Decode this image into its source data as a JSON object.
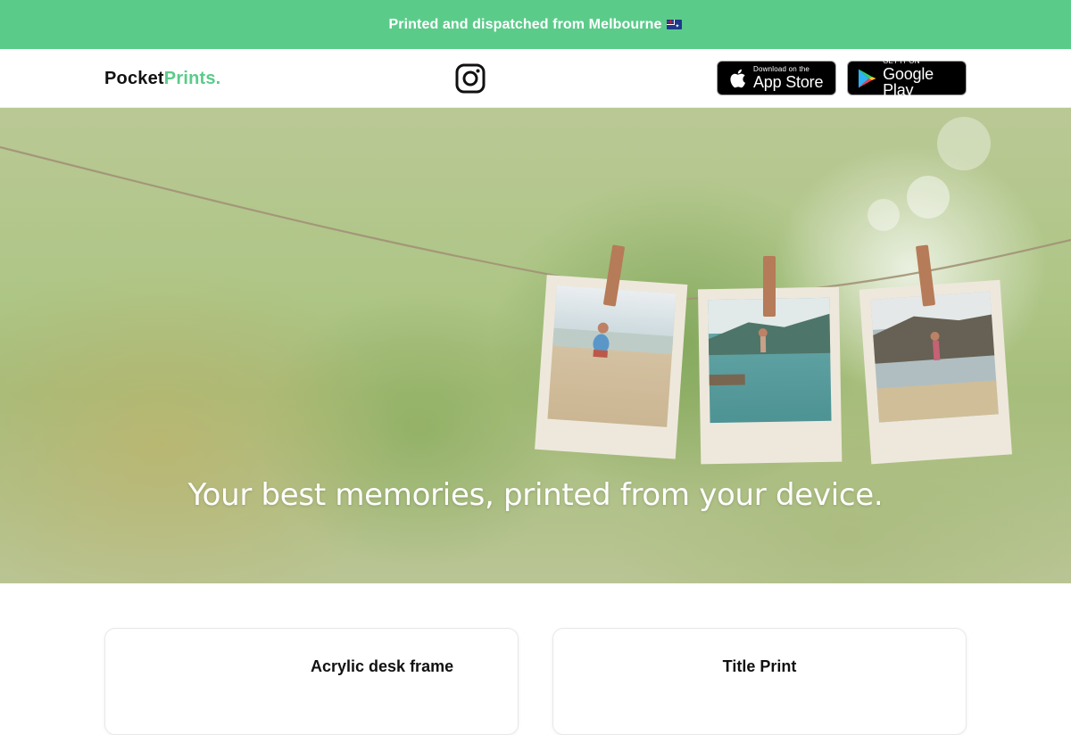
{
  "promo": {
    "text": "Printed and dispatched from Melbourne",
    "flag_icon": "australia-flag-icon"
  },
  "header": {
    "logo_primary": "Pocket",
    "logo_accent": "Prints.",
    "social_icon": "instagram-icon",
    "app_store": {
      "small": "Download on the",
      "big": "App Store"
    },
    "google_play": {
      "small": "GET IT ON",
      "big": "Google Play"
    }
  },
  "hero": {
    "headline": "Your best memories, printed from your device."
  },
  "products": [
    {
      "title": "Acrylic desk frame"
    },
    {
      "title": "Title Print"
    }
  ],
  "colors": {
    "brand_green": "#5bcb8a",
    "text_dark": "#111111"
  }
}
